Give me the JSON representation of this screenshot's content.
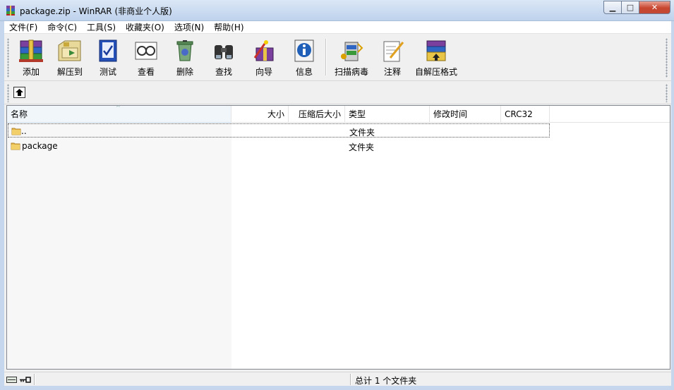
{
  "window": {
    "title": "package.zip - WinRAR (非商业个人版)",
    "controls": {
      "minimize": "▁",
      "maximize": "□",
      "close": "✕"
    }
  },
  "menu": [
    "文件(F)",
    "命令(C)",
    "工具(S)",
    "收藏夹(O)",
    "选项(N)",
    "帮助(H)"
  ],
  "toolbar": [
    {
      "label": "添加",
      "icon": "add-archive-icon"
    },
    {
      "label": "解压到",
      "icon": "extract-to-icon"
    },
    {
      "label": "测试",
      "icon": "test-icon"
    },
    {
      "label": "查看",
      "icon": "view-icon"
    },
    {
      "label": "删除",
      "icon": "delete-icon"
    },
    {
      "label": "查找",
      "icon": "find-icon"
    },
    {
      "label": "向导",
      "icon": "wizard-icon"
    },
    {
      "label": "信息",
      "icon": "info-icon"
    },
    {
      "label": "扫描病毒",
      "icon": "scan-virus-icon"
    },
    {
      "label": "注释",
      "icon": "comment-icon"
    },
    {
      "label": "自解压格式",
      "icon": "sfx-icon"
    }
  ],
  "columns": [
    "名称",
    "大小",
    "压缩后大小",
    "类型",
    "修改时间",
    "CRC32"
  ],
  "rows": [
    {
      "name": "..",
      "type": "文件夹",
      "icon": "folder-up-icon"
    },
    {
      "name": "package",
      "type": "文件夹",
      "icon": "folder-icon"
    }
  ],
  "status": {
    "text": "总计 1 个文件夹"
  },
  "colors": {
    "title_bar": "#c9daf0",
    "close_button": "#c8462f",
    "frame": "#c6d7ed"
  }
}
